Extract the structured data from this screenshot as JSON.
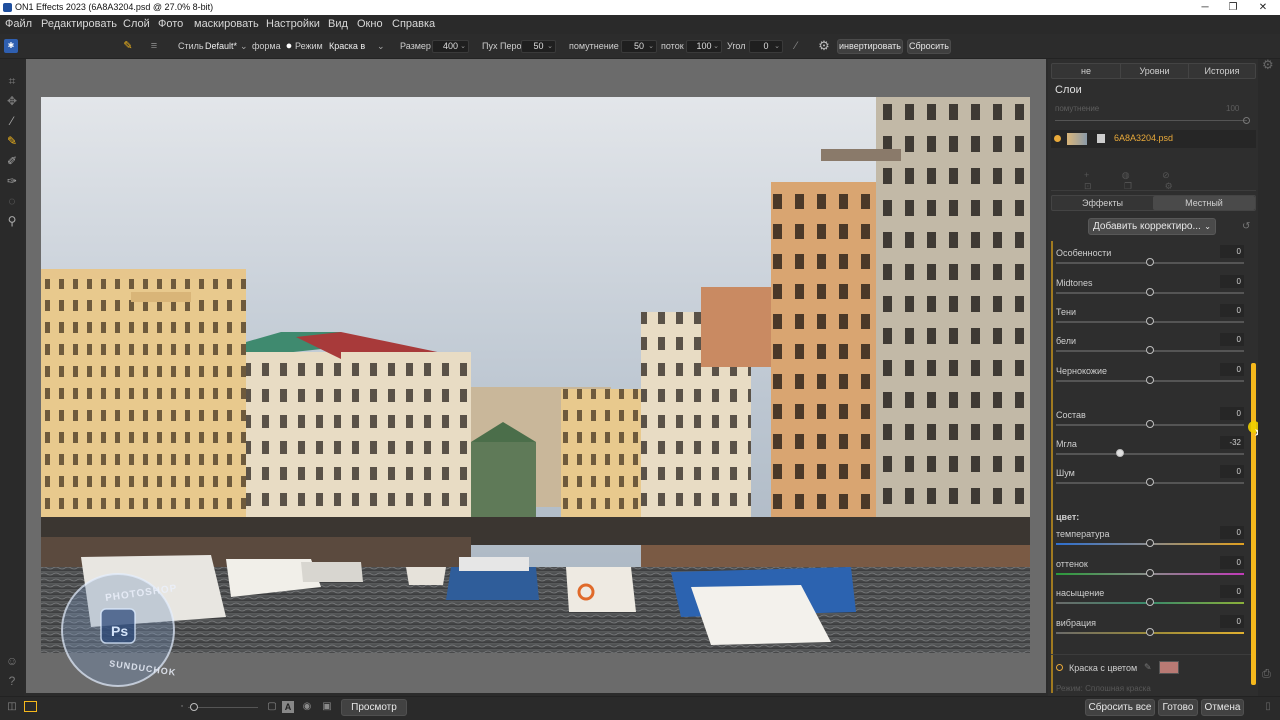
{
  "window": {
    "title": "ON1 Effects 2023 (6A8A3204.psd @ 27.0% 8-bit)",
    "controls": {
      "minimize": "─",
      "restore": "❐",
      "close": "✕"
    }
  },
  "menu": [
    "Файл",
    "Редактировать",
    "Слой",
    "Фото",
    "маскировать",
    "Настройки",
    "Вид",
    "Окно",
    "Справка"
  ],
  "options": {
    "style_label": "Стиль",
    "style_value": "Default*",
    "shape_label": "форма",
    "mode_label": "Режим",
    "mode_value": "Краска в",
    "size_label": "Размер",
    "size_value": "400",
    "feather_label": "Пух Перо",
    "feather_value": "50",
    "opacity_label": "помутнение",
    "opacity_value": "50",
    "flow_label": "поток",
    "flow_value": "100",
    "angle_label": "Угол",
    "angle_value": "0",
    "invert_button": "инвертировать",
    "reset_button": "Сбросить"
  },
  "panel": {
    "top_tabs": [
      "не",
      "Уровни",
      "История"
    ],
    "layers_title": "Слои",
    "opacity_label": "помутнение",
    "opacity_value": "100",
    "layer_name": "6A8A3204.psd",
    "sub_tabs": [
      "Эффекты",
      "Местный"
    ],
    "add_adjustment": "Добавить корректиро...",
    "adjustments": [
      {
        "label": "Особенности",
        "value": "0",
        "pos": 0.5
      },
      {
        "label": "Midtones",
        "value": "0",
        "pos": 0.5
      },
      {
        "label": "Тени",
        "value": "0",
        "pos": 0.5
      },
      {
        "label": "бели",
        "value": "0",
        "pos": 0.5
      },
      {
        "label": "Чернокожие",
        "value": "0",
        "pos": 0.5
      }
    ],
    "details": [
      {
        "label": "Состав",
        "value": "0",
        "pos": 0.5
      },
      {
        "label": "Мгла",
        "value": "-32",
        "pos": 0.34
      },
      {
        "label": "Шум",
        "value": "0",
        "pos": 0.5
      }
    ],
    "color_section_title": "цвет:",
    "color_adjustments": [
      {
        "label": "температура",
        "value": "0",
        "pos": 0.5,
        "gradient": "linear-gradient(90deg,#2d6fd0,#8a8a8a,#e0a020)"
      },
      {
        "label": "оттенок",
        "value": "0",
        "pos": 0.5,
        "gradient": "linear-gradient(90deg,#2a9a3a,#8a8a8a,#c03ab8)"
      },
      {
        "label": "насыщение",
        "value": "0",
        "pos": 0.5,
        "gradient": "linear-gradient(90deg,#6a6a6a,#3a8a6a,#8ab03a)"
      },
      {
        "label": "вибрация",
        "value": "0",
        "pos": 0.5,
        "gradient": "linear-gradient(90deg,#6a6a6a,#9a8a3a,#e0b030)"
      }
    ],
    "color_paint_label": "Краска с цветом",
    "color_paint_swatch": "#b97a74",
    "mode_hint": "Режим: Сплошная краска"
  },
  "bottom": {
    "preview_button": "Просмотр",
    "reset_all_button": "Сбросить все",
    "done_button": "Готово",
    "cancel_button": "Отмена"
  },
  "watermark": {
    "top_text": "PHOTOSHOP",
    "bottom_text": "SUNDUCHOK",
    "badge": "Ps"
  },
  "colors": {
    "accent": "#f5b81c",
    "layer_name": "#e8a93a"
  }
}
